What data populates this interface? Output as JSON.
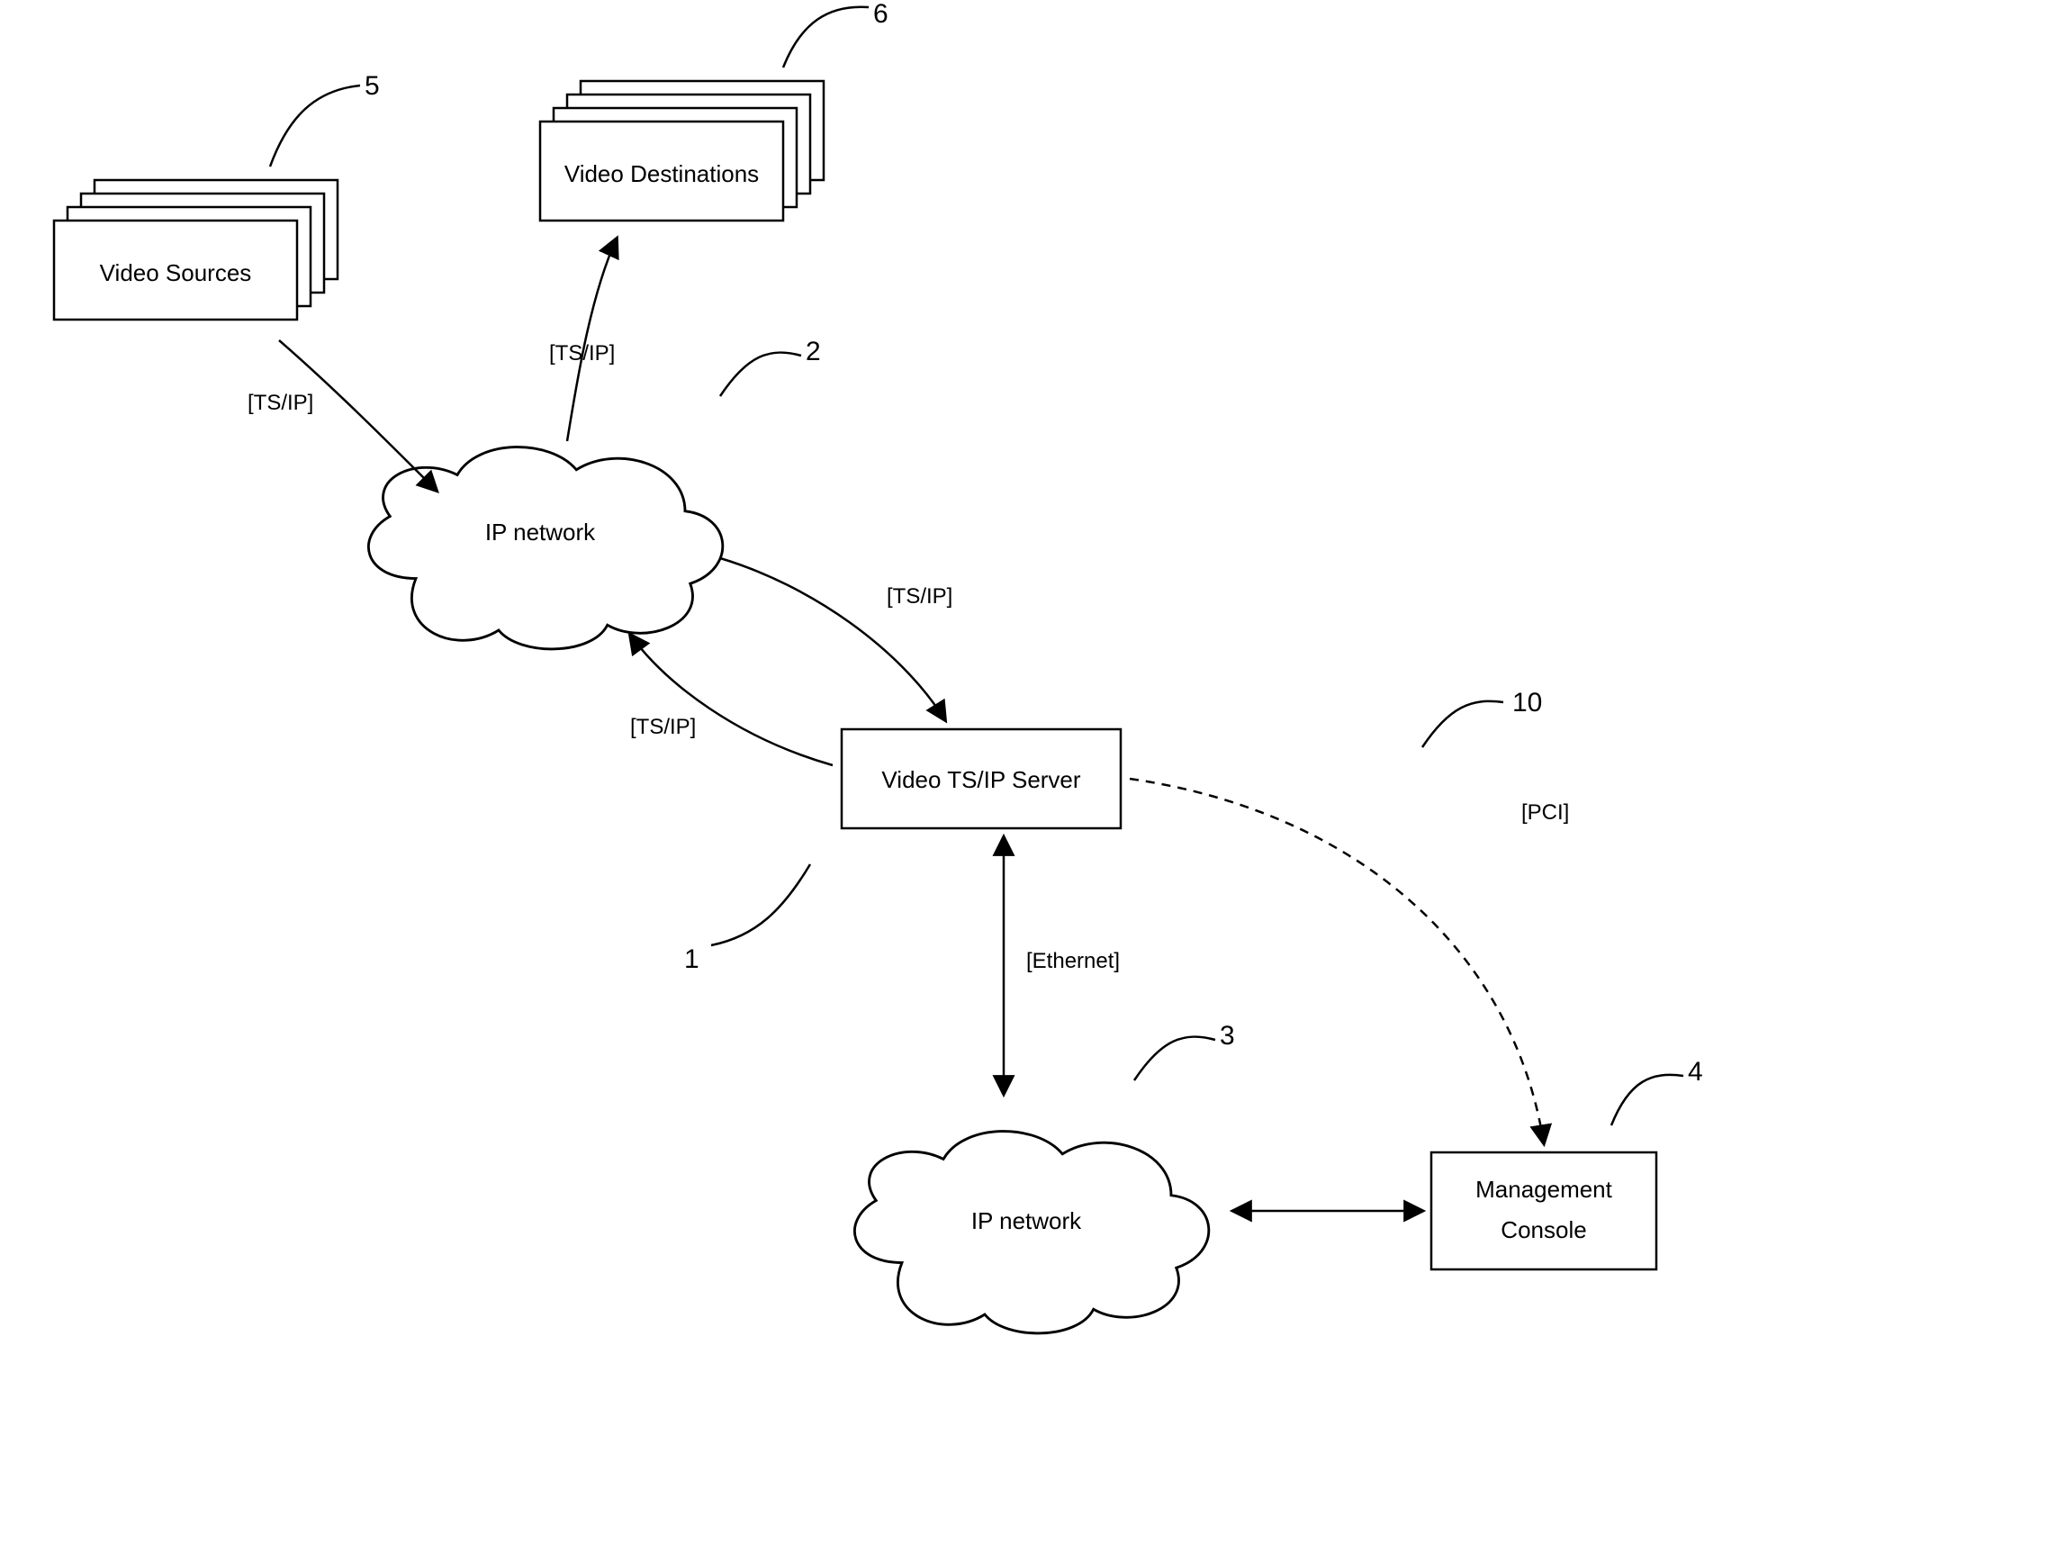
{
  "diagram": {
    "nodes": {
      "video_sources": {
        "label": "Video Sources",
        "ref": "5"
      },
      "video_destinations": {
        "label": "Video Destinations",
        "ref": "6"
      },
      "ip_network_top": {
        "label": "IP network",
        "ref": "2"
      },
      "video_server": {
        "label": "Video TS/IP Server",
        "ref": "1"
      },
      "ip_network_bottom": {
        "label": "IP network",
        "ref": "3"
      },
      "mgmt_console": {
        "label_line1": "Management",
        "label_line2": "Console",
        "ref": "4"
      }
    },
    "edges": {
      "src_to_net": {
        "label": "[TS/IP]"
      },
      "net_to_dest": {
        "label": "[TS/IP]"
      },
      "net_to_server": {
        "label": "[TS/IP]"
      },
      "server_to_net": {
        "label": "[TS/IP]"
      },
      "server_to_net2": {
        "label": "[Ethernet]"
      },
      "server_to_mgmt": {
        "label": "[PCI]",
        "ref": "10"
      }
    }
  }
}
